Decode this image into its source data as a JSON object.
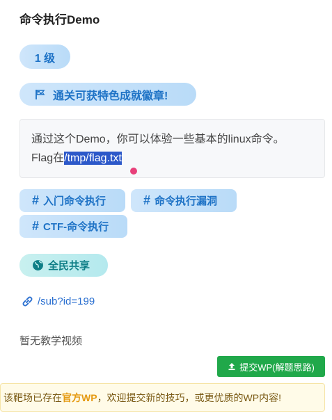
{
  "title": "命令执行Demo",
  "level": "1 级",
  "achievement": "通关可获特色成就徽章!",
  "description": {
    "line1": "通过这个Demo，你可以体验一些基本的linux命令。",
    "flag_prefix": "Flag在",
    "flag_path": "/tmp/flag.txt"
  },
  "tags": [
    "入门命令执行",
    "命令执行漏洞",
    "CTF-命令执行"
  ],
  "share_label": "全民共享",
  "link": "/sub?id=199",
  "no_video": "暂无教学视频",
  "submit_label": "提交WP(解题思路)",
  "notice": {
    "prefix": "该靶场已存在",
    "highlight": "官方WP",
    "suffix": "，欢迎提交新的技巧，或更优质的WP内容!"
  },
  "colors": {
    "accent": "#1f73c6",
    "selection": "#2c58c9",
    "submit": "#20a84a",
    "share": "#0e7e86",
    "notice_highlight": "#e59a12"
  }
}
